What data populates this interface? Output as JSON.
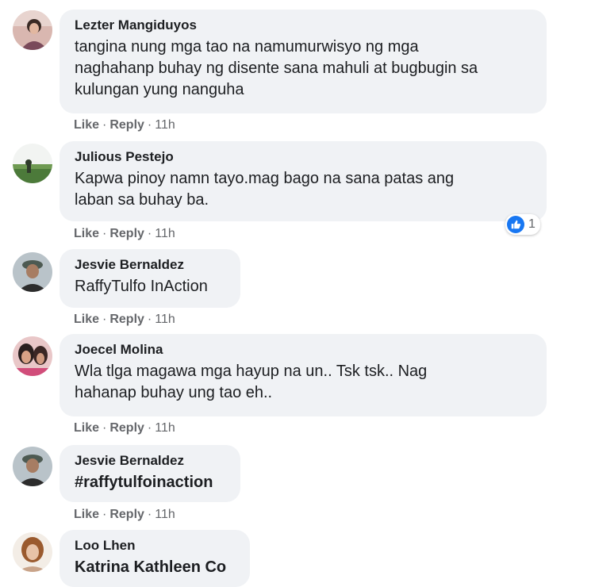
{
  "colors": {
    "bubble_bg": "#f0f2f5",
    "text": "#1c1e21",
    "meta": "#65676b",
    "like_blue": "#1877f2"
  },
  "comments": [
    {
      "name": "Lezter Mangiduyos",
      "text": "tangina nung mga tao na namumurwisyo ng mga\nnaghahanp buhay ng disente sana mahuli at bugbugin sa\nkulungan yung nanguha",
      "like": "Like",
      "reply": "Reply",
      "time": "11h"
    },
    {
      "name": "Julious Pestejo",
      "text": "Kapwa pinoy namn tayo.mag bago na sana patas ang\nlaban sa buhay ba.",
      "like": "Like",
      "reply": "Reply",
      "time": "11h",
      "reaction": {
        "icon": "thumbs-up-icon",
        "count": "1"
      }
    },
    {
      "name": "Jesvie Bernaldez",
      "text": "RaffyTulfo InAction",
      "like": "Like",
      "reply": "Reply",
      "time": "11h"
    },
    {
      "name": "Joecel Molina",
      "text": "Wla tlga magawa mga hayup na un.. Tsk tsk.. Nag\nhahanap buhay ung tao eh..",
      "like": "Like",
      "reply": "Reply",
      "time": "11h"
    },
    {
      "name": "Jesvie Bernaldez",
      "text": "#raffytulfoinaction",
      "like": "Like",
      "reply": "Reply",
      "time": "11h"
    },
    {
      "name": "Loo Lhen",
      "text": "Katrina Kathleen Co"
    }
  ]
}
